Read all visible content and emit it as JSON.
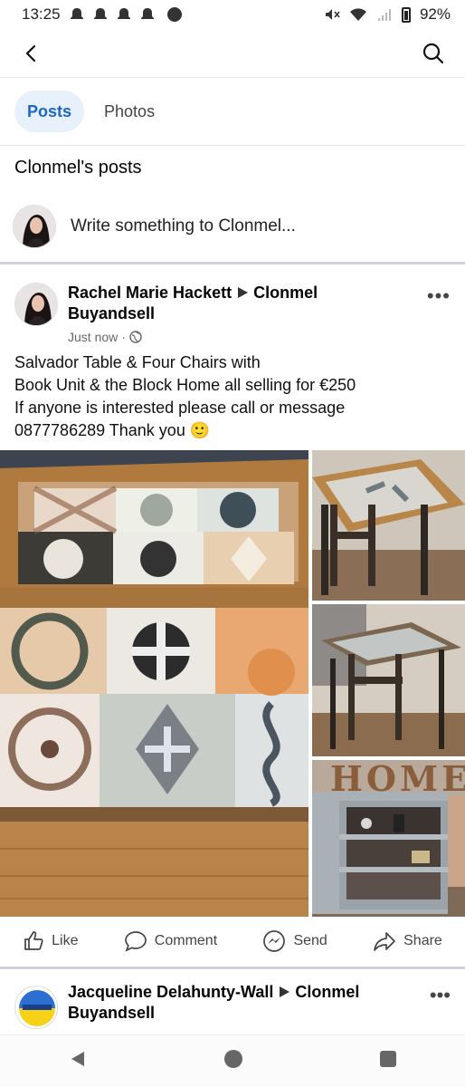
{
  "status": {
    "time": "13:25",
    "battery": "92%"
  },
  "tabs": [
    {
      "label": "Posts",
      "active": true
    },
    {
      "label": "Photos",
      "active": false
    }
  ],
  "section_title": "Clonmel's posts",
  "composer": {
    "prompt": "Write something to Clonmel..."
  },
  "post": {
    "author": "Rachel Marie Hackett",
    "group": "Clonmel Buyandsell",
    "time": "Just now",
    "text": [
      "Salvador Table & Four Chairs with",
      "Book Unit & the Block Home all selling for €250",
      "If anyone is interested please call or message",
      "0877786289 Thank you 🙂"
    ],
    "photo_sign": "HOME"
  },
  "actions": {
    "like": "Like",
    "comment": "Comment",
    "send": "Send",
    "share": "Share"
  },
  "post2": {
    "author": "Jacqueline Delahunty-Wall",
    "group": "Clonmel Buyandsell"
  },
  "colors": {
    "accent": "#1b67c8",
    "tab_bg": "#e7f0fb"
  }
}
